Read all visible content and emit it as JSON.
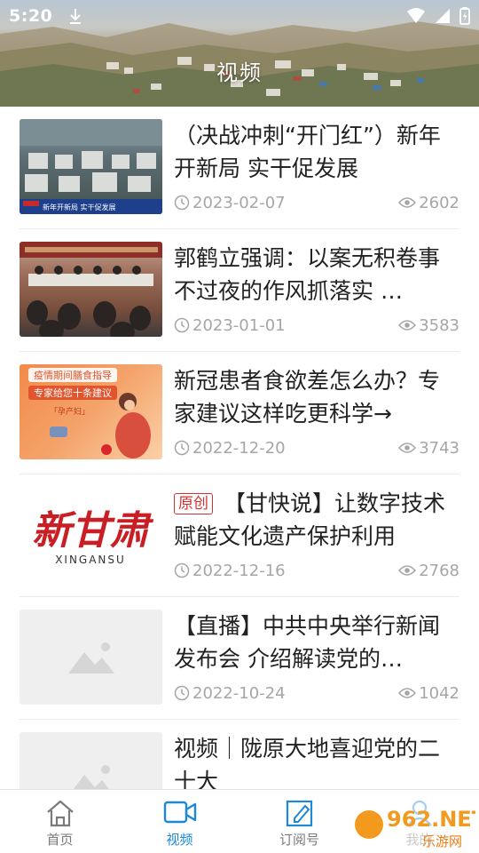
{
  "status_bar": {
    "time": "5:20"
  },
  "header": {
    "title": "视频"
  },
  "news": [
    {
      "title": "（决战冲刺“开门红”）新年开新局 实干促发展",
      "date": "2023-02-07",
      "views": "2602",
      "thumb_caption": "新年开新局 实干促发展"
    },
    {
      "title": "郭鹤立强调：以案无积卷事不过夜的作风抓落实 …",
      "date": "2023-01-01",
      "views": "3583"
    },
    {
      "title": "新冠患者食欲差怎么办？专家建议这样吃更科学→",
      "date": "2022-12-20",
      "views": "3743",
      "thumb_line1": "疫情期间膳食指导",
      "thumb_line2": "专家给您十条建议",
      "thumb_tag": "「孕产妇」"
    },
    {
      "tag": "原创",
      "title": "【甘快说】让数字技术赋能文化遗产保护利用",
      "date": "2022-12-16",
      "views": "2768",
      "thumb_brand": "新甘肃",
      "thumb_brand_en": "XINGANSU"
    },
    {
      "title": "【直播】中共中央举行新闻发布会 介绍解读党的…",
      "date": "2022-10-24",
      "views": "1042"
    },
    {
      "title": "视频｜陇原大地喜迎党的二十大",
      "date": "",
      "views": ""
    }
  ],
  "tabs": [
    {
      "label": "首页",
      "icon": "home-icon"
    },
    {
      "label": "视频",
      "icon": "video-icon",
      "active": true
    },
    {
      "label": "订阅号",
      "icon": "subscribe-icon"
    },
    {
      "label": "我的",
      "icon": "user-icon"
    }
  ],
  "colors": {
    "accent": "#1e88d6",
    "tag_red": "#d03232",
    "meta_gray": "#a6a6a6"
  },
  "watermark": {
    "text": "962.NET",
    "sub": "乐游网"
  }
}
